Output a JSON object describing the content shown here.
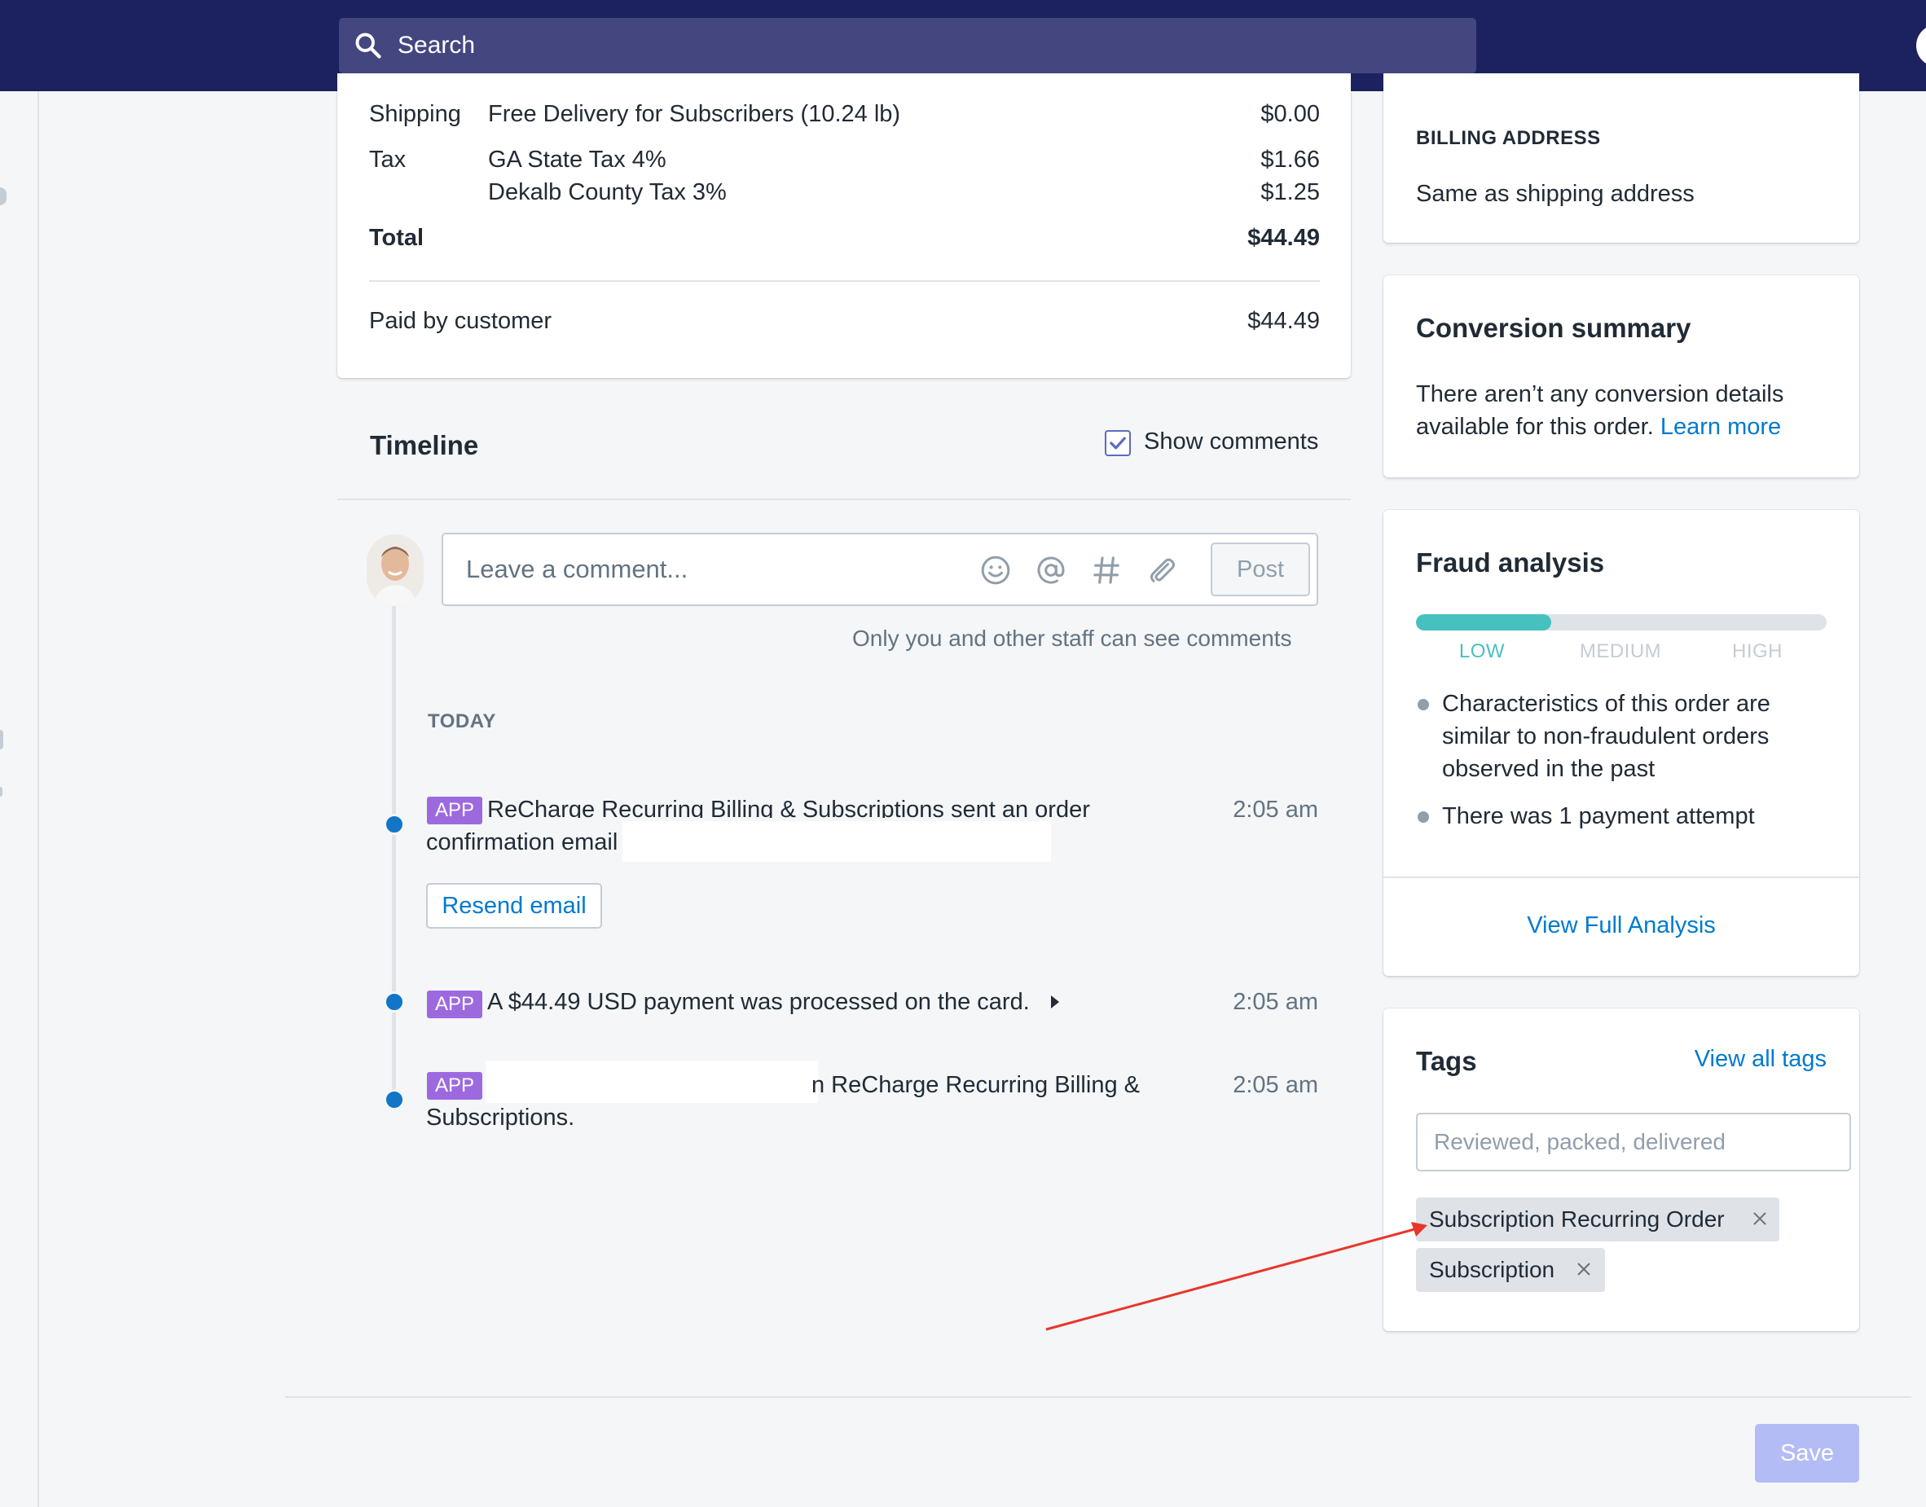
{
  "header": {
    "search_placeholder": "Search"
  },
  "order_summary": {
    "shipping_label": "Shipping",
    "shipping_method": "Free Delivery for Subscribers (10.24 lb)",
    "shipping_amount": "$0.00",
    "tax_label": "Tax",
    "tax_lines": [
      {
        "name": "GA State Tax 4%",
        "amount": "$1.66"
      },
      {
        "name": "Dekalb County Tax 3%",
        "amount": "$1.25"
      }
    ],
    "total_label": "Total",
    "total_amount": "$44.49",
    "paid_label": "Paid by customer",
    "paid_amount": "$44.49"
  },
  "timeline": {
    "title": "Timeline",
    "show_comments_label": "Show comments",
    "show_comments_checked": true,
    "comment_placeholder": "Leave a comment...",
    "post_label": "Post",
    "staff_note": "Only you and other staff can see comments",
    "day_label": "TODAY",
    "events": [
      {
        "badge": "APP",
        "line1": "ReCharge Recurring Billing & Subscriptions sent an order",
        "line2": "confirmation email",
        "time": "2:05 am",
        "action_label": "Resend email"
      },
      {
        "badge": "APP",
        "line1": "A $44.49 USD payment was processed on the card.",
        "time": "2:05 am"
      },
      {
        "badge": "APP",
        "line1": "n ReCharge Recurring Billing &",
        "line2": "Subscriptions.",
        "time": "2:05 am"
      }
    ]
  },
  "billing": {
    "title": "BILLING ADDRESS",
    "value": "Same as shipping address"
  },
  "conversion": {
    "title": "Conversion summary",
    "line1": "There aren’t any conversion details",
    "line2": "available for this order.",
    "link_label": "Learn more"
  },
  "fraud": {
    "title": "Fraud analysis",
    "risk_level": "LOW",
    "risk_fill_fraction": 0.33,
    "risk_labels": [
      "LOW",
      "MEDIUM",
      "HIGH"
    ],
    "bullets": [
      {
        "lines": [
          "Characteristics of this order are",
          "similar to non-fraudulent orders",
          "observed in the past"
        ]
      },
      {
        "lines": [
          "There was 1 payment attempt"
        ]
      }
    ],
    "link_label": "View Full Analysis"
  },
  "tags": {
    "title": "Tags",
    "view_all_label": "View all tags",
    "input_placeholder": "Reviewed, packed, delivered",
    "items": [
      "Subscription Recurring Order",
      "Subscription"
    ]
  },
  "footer": {
    "save_label": "Save"
  },
  "colors": {
    "topbar": "#1c2260",
    "accent_link": "#007ace",
    "app_badge": "#9c6ade",
    "risk_low": "#47c1bf",
    "annotation_arrow": "#e8362b"
  }
}
